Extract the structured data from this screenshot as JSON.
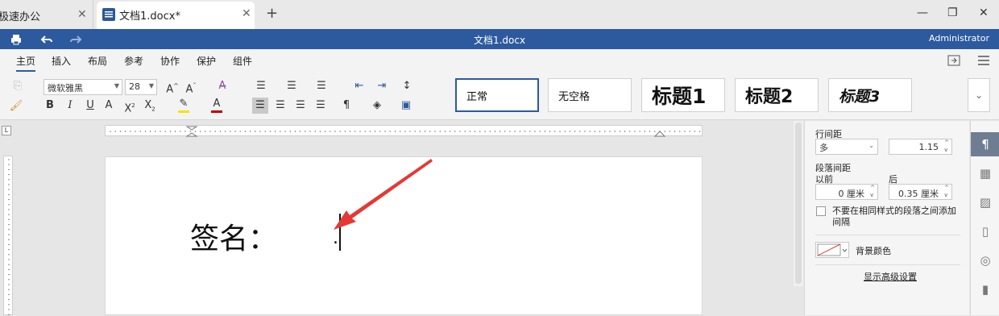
{
  "tabs": {
    "app_tab": "极速办公",
    "doc_tab": "文档1.docx*",
    "new_tab": "+"
  },
  "window": {
    "minimize": "—",
    "restore": "❐",
    "close": "✕"
  },
  "titlebar": {
    "title": "文档1.docx",
    "user": "Administrator"
  },
  "menu": [
    "主页",
    "插入",
    "布局",
    "参考",
    "协作",
    "保护",
    "组件"
  ],
  "toolbar": {
    "font_name": "微软雅黑",
    "font_size": "28",
    "styles": [
      "正常",
      "无空格",
      "标题1",
      "标题2",
      "标题3"
    ]
  },
  "document": {
    "signature_label": "签名：",
    "paragraph_mark": "."
  },
  "panel": {
    "line_spacing_label": "行间距",
    "line_spacing_mode": "多",
    "line_spacing_value": "1.15",
    "para_spacing_label": "段落间距",
    "before_label": "以前",
    "after_label": "后",
    "before_value": "0 厘米",
    "after_value": "0.35 厘米",
    "no_space_checkbox": "不要在相同样式的段落之间添加间隔",
    "bg_color_label": "背景颜色",
    "advanced_link": "显示高级设置"
  },
  "colors": {
    "accent": "#2d5a9e",
    "arrow": "#e53935",
    "highlight": "#f5e400",
    "font_color": "#c00000"
  }
}
